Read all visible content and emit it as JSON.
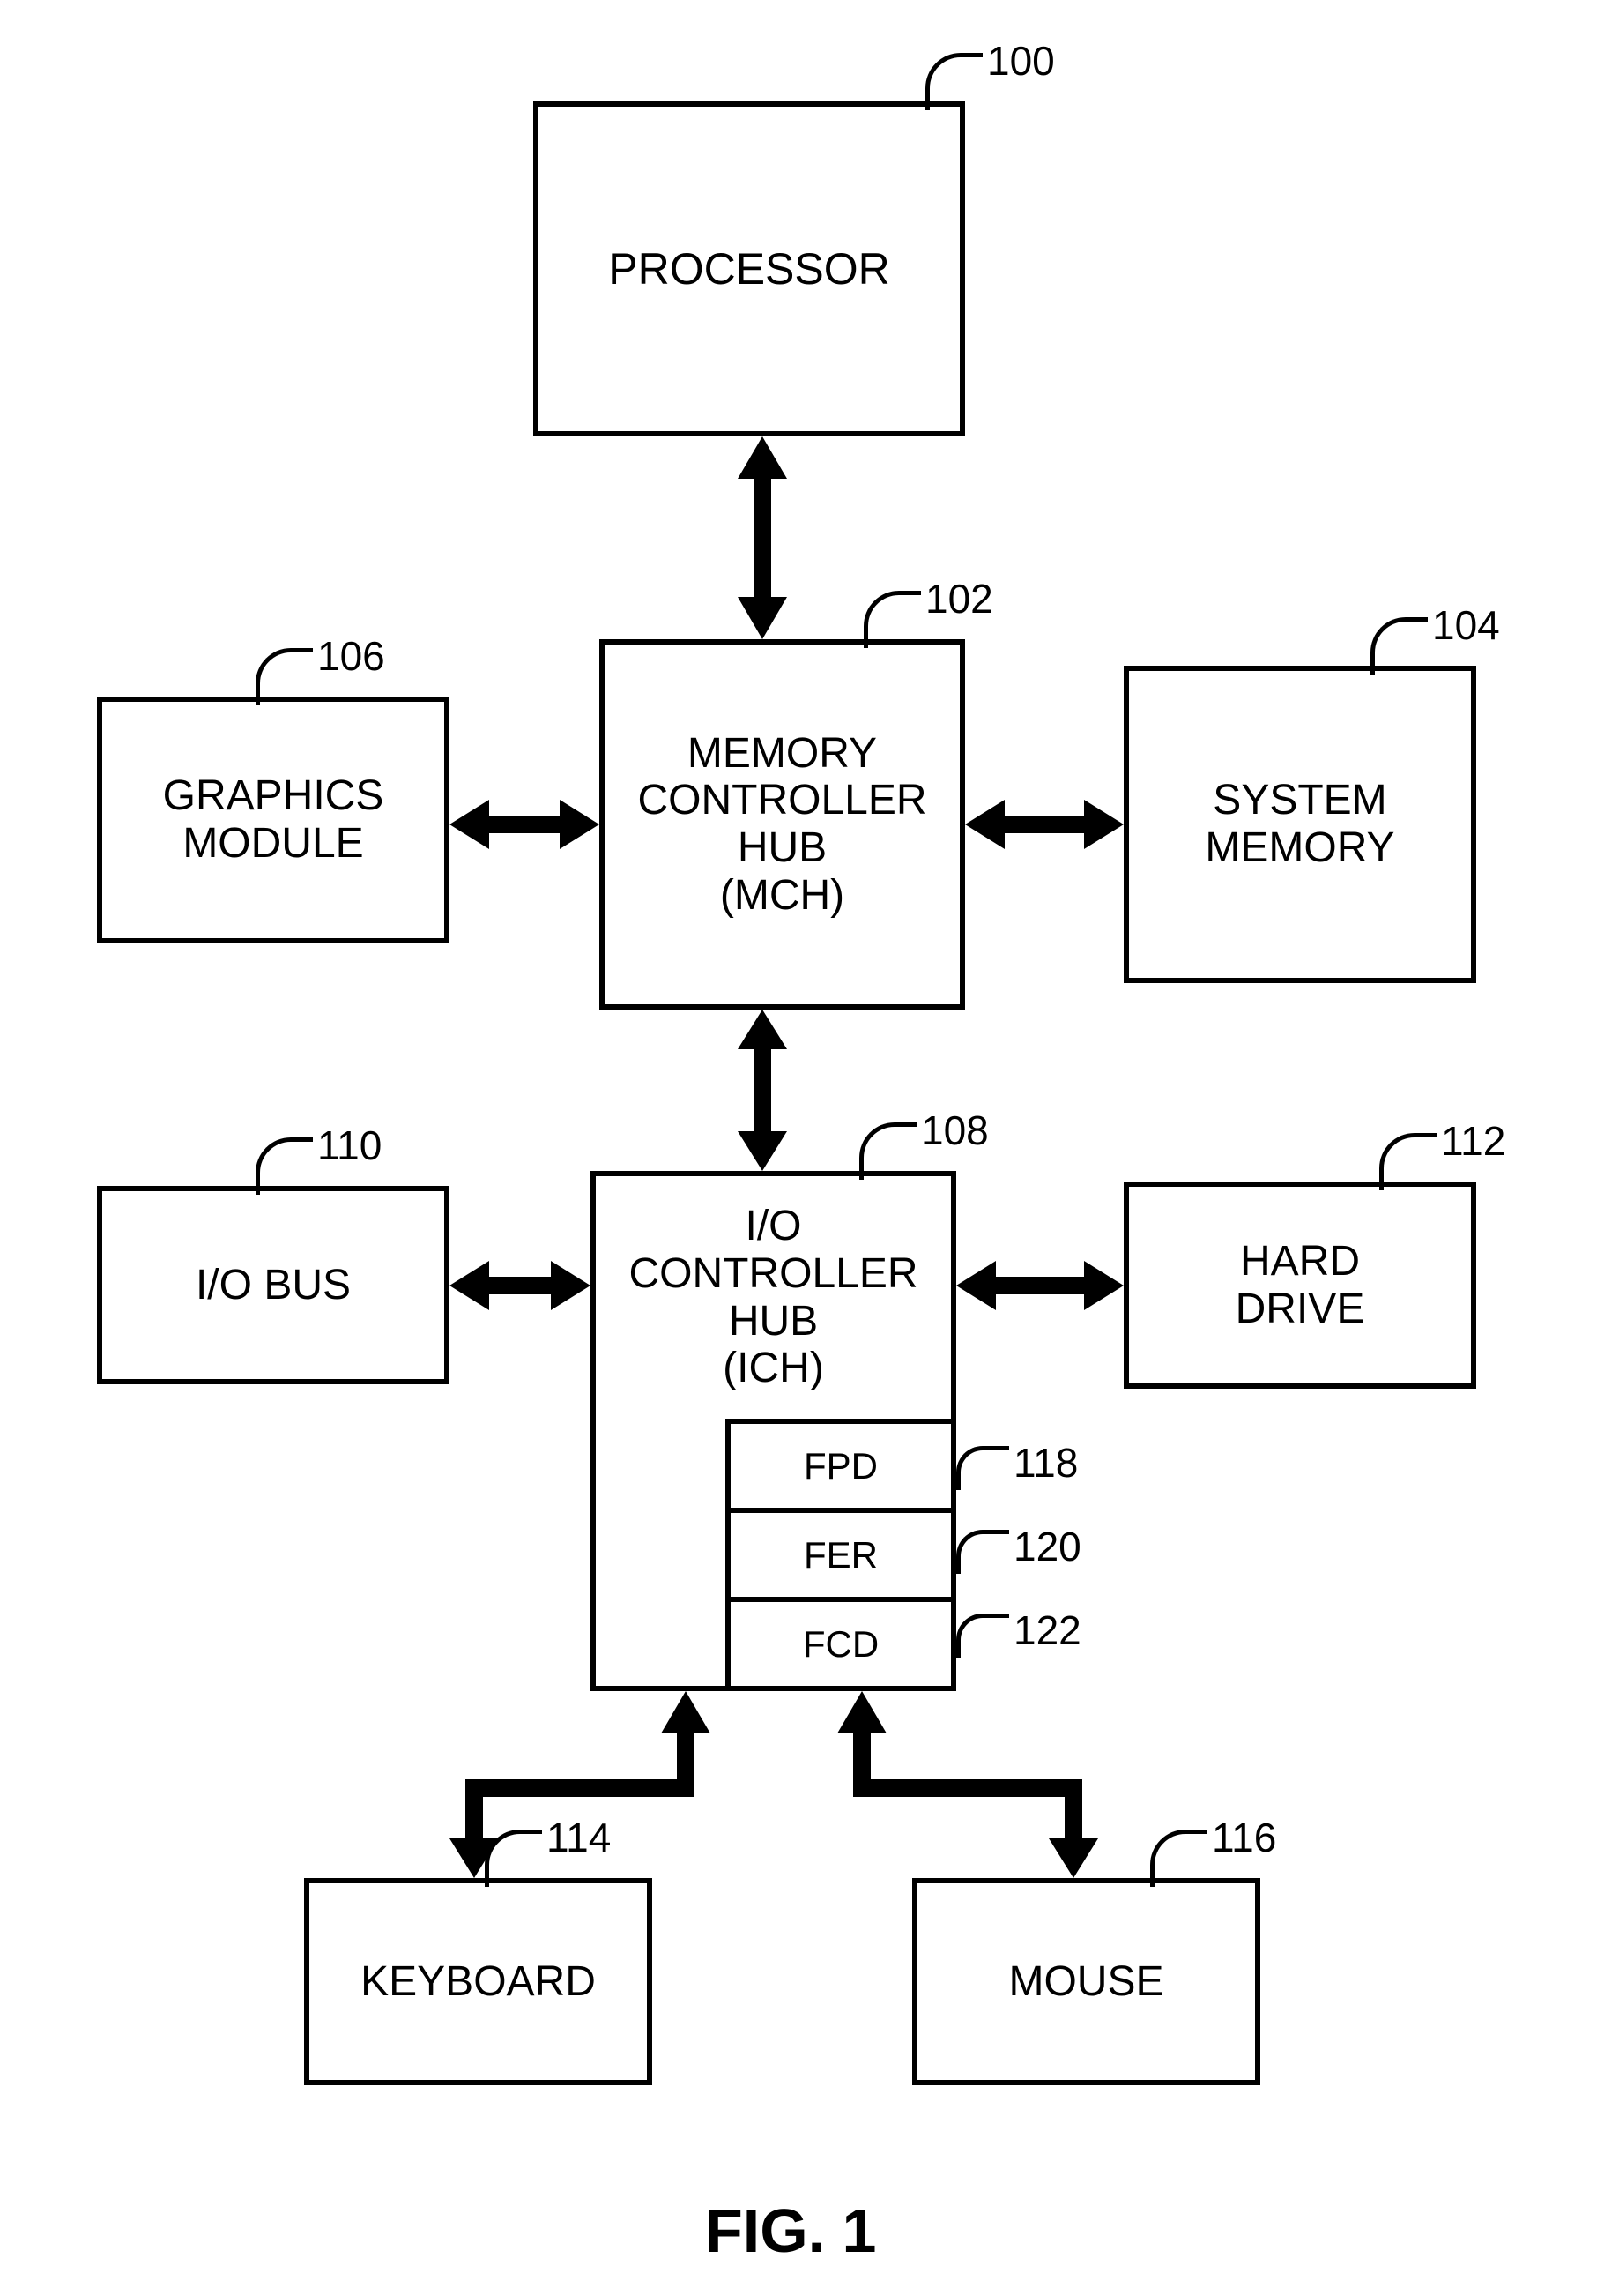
{
  "figure_label": "FIG. 1",
  "blocks": {
    "processor": {
      "label": "PROCESSOR",
      "ref": "100"
    },
    "mch": {
      "label": "MEMORY\nCONTROLLER\nHUB\n(MCH)",
      "ref": "102"
    },
    "sysmem": {
      "label": "SYSTEM\nMEMORY",
      "ref": "104"
    },
    "graphics": {
      "label": "GRAPHICS\nMODULE",
      "ref": "106"
    },
    "ich": {
      "label": "I/O\nCONTROLLER\nHUB\n(ICH)",
      "ref": "108"
    },
    "iobus": {
      "label": "I/O BUS",
      "ref": "110"
    },
    "harddrive": {
      "label": "HARD\nDRIVE",
      "ref": "112"
    },
    "keyboard": {
      "label": "KEYBOARD",
      "ref": "114"
    },
    "mouse": {
      "label": "MOUSE",
      "ref": "116"
    },
    "fpd": {
      "label": "FPD",
      "ref": "118"
    },
    "fer": {
      "label": "FER",
      "ref": "120"
    },
    "fcd": {
      "label": "FCD",
      "ref": "122"
    }
  }
}
